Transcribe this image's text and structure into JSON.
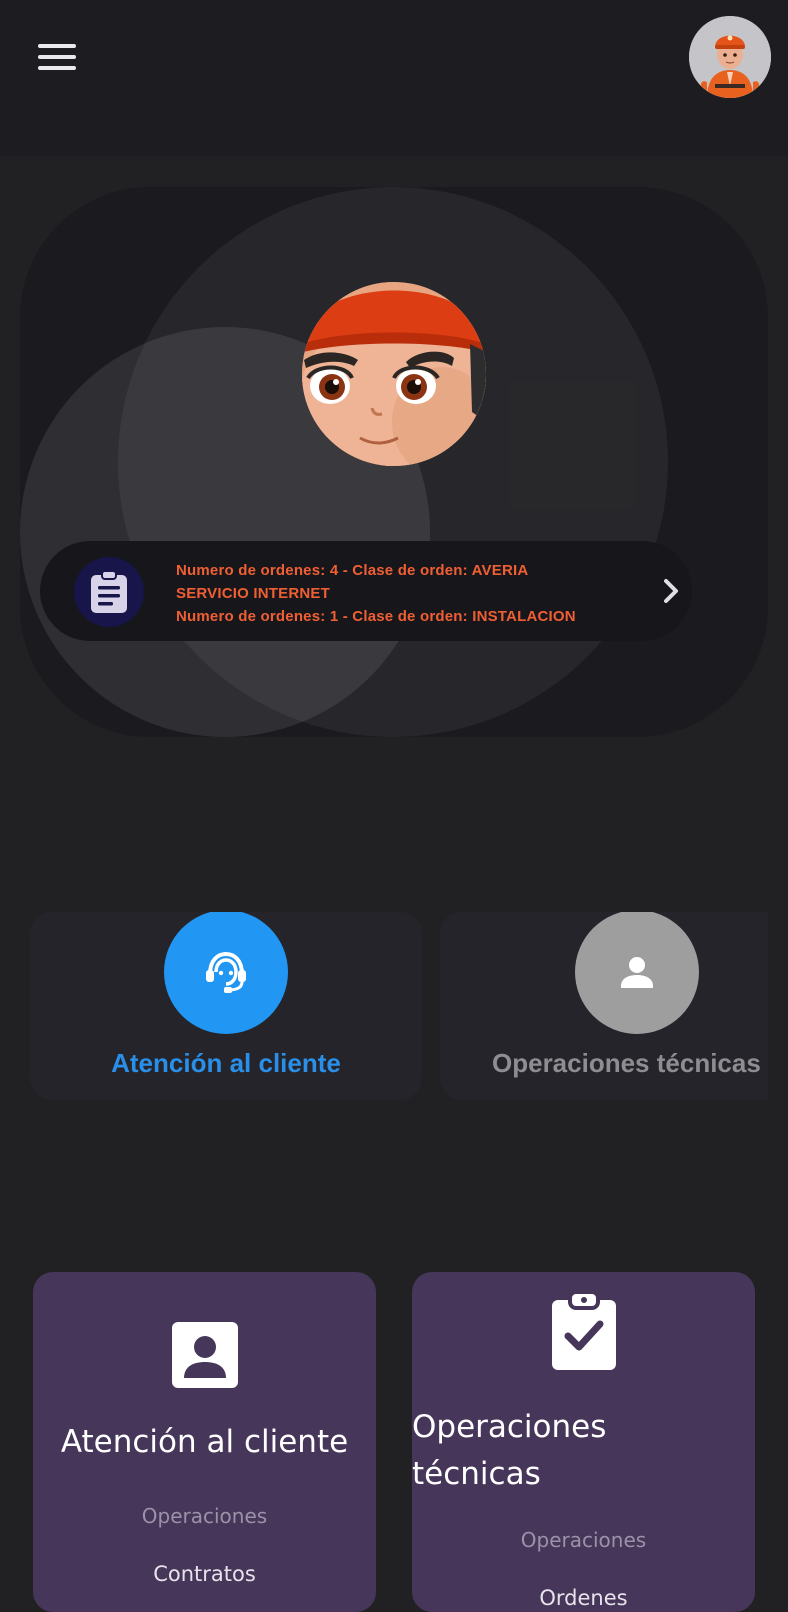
{
  "colors": {
    "background": "#212124",
    "app_bar": "#1c1c21",
    "accent_blue": "#2196f3",
    "order_text": "#f05f33",
    "tile_purple": "#463659",
    "inactive_gray": "#9e9e9e"
  },
  "header": {
    "menu_icon": "hamburger-menu-icon",
    "avatar": "technician-avatar"
  },
  "orders": {
    "icon": "clipboard-list-icon",
    "lines": [
      "Numero de ordenes: 4 - Clase de orden: AVERIA",
      "SERVICIO INTERNET",
      "Numero de ordenes: 1 - Clase de orden: INSTALACION"
    ],
    "chevron_icon": "chevron-right-icon"
  },
  "categories": [
    {
      "label": "Atención al cliente",
      "icon": "support-agent-icon",
      "active": true
    },
    {
      "label": "Operaciones técnicas",
      "icon": "person-icon",
      "active": false
    }
  ],
  "tiles": [
    {
      "title": "Atención al cliente",
      "subtitle": "Operaciones",
      "item": "Contratos",
      "icon": "contact-card-icon"
    },
    {
      "title": "Operaciones técnicas",
      "subtitle": "Operaciones",
      "item": "Ordenes",
      "icon": "clipboard-check-icon"
    }
  ]
}
